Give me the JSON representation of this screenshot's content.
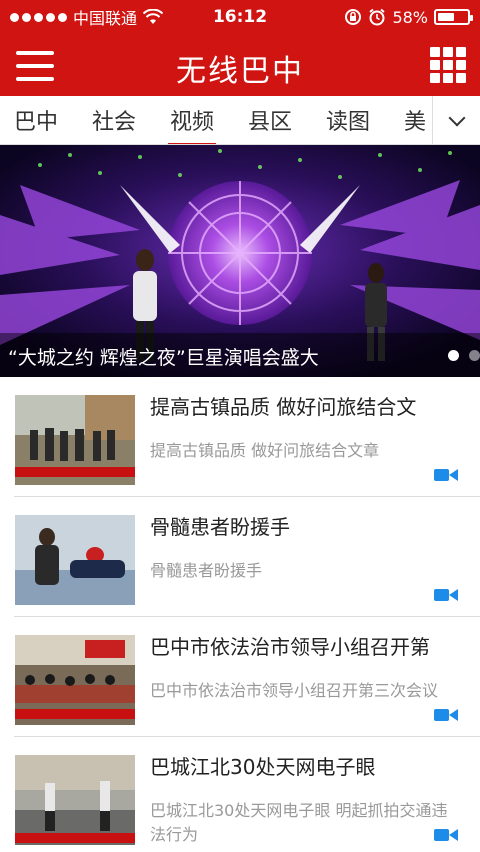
{
  "status_bar": {
    "carrier": "中国联通",
    "time": "16:12",
    "battery_text": "58%",
    "battery_level": 0.58,
    "signal_icon": "signal-dots-icon",
    "wifi_icon": "wifi-icon",
    "lock_icon": "rotation-lock-icon",
    "alarm_icon": "alarm-icon"
  },
  "header": {
    "title": "无线巴中",
    "menu_icon": "hamburger-menu-icon",
    "grid_icon": "grid-apps-icon",
    "bg_color": "#cf1412"
  },
  "tabs": {
    "items": [
      {
        "label": "巴中",
        "active": false
      },
      {
        "label": "社会",
        "active": false
      },
      {
        "label": "视频",
        "active": true
      },
      {
        "label": "县区",
        "active": false
      },
      {
        "label": "读图",
        "active": false
      },
      {
        "label": "美",
        "active": false
      }
    ],
    "more_icon": "chevron-down-icon"
  },
  "banner": {
    "caption": "“大城之约 辉煌之夜”巨星演唱会盛大",
    "slide_count": 2,
    "active_slide": 1
  },
  "news": [
    {
      "title": "提高古镇品质 做好问旅结合文",
      "subtitle": "提高古镇品质 做好问旅结合文章",
      "icon": "video-camera-icon"
    },
    {
      "title": "骨髓患者盼援手",
      "subtitle": "骨髓患者盼援手",
      "icon": "video-camera-icon"
    },
    {
      "title": "巴中市依法治市领导小组召开第",
      "subtitle": "巴中市依法治市领导小组召开第三次会议",
      "icon": "video-camera-icon"
    },
    {
      "title": "巴城江北30处天网电子眼",
      "subtitle": "巴城江北30处天网电子眼 明起抓拍交通违法行为",
      "icon": "video-camera-icon"
    }
  ]
}
